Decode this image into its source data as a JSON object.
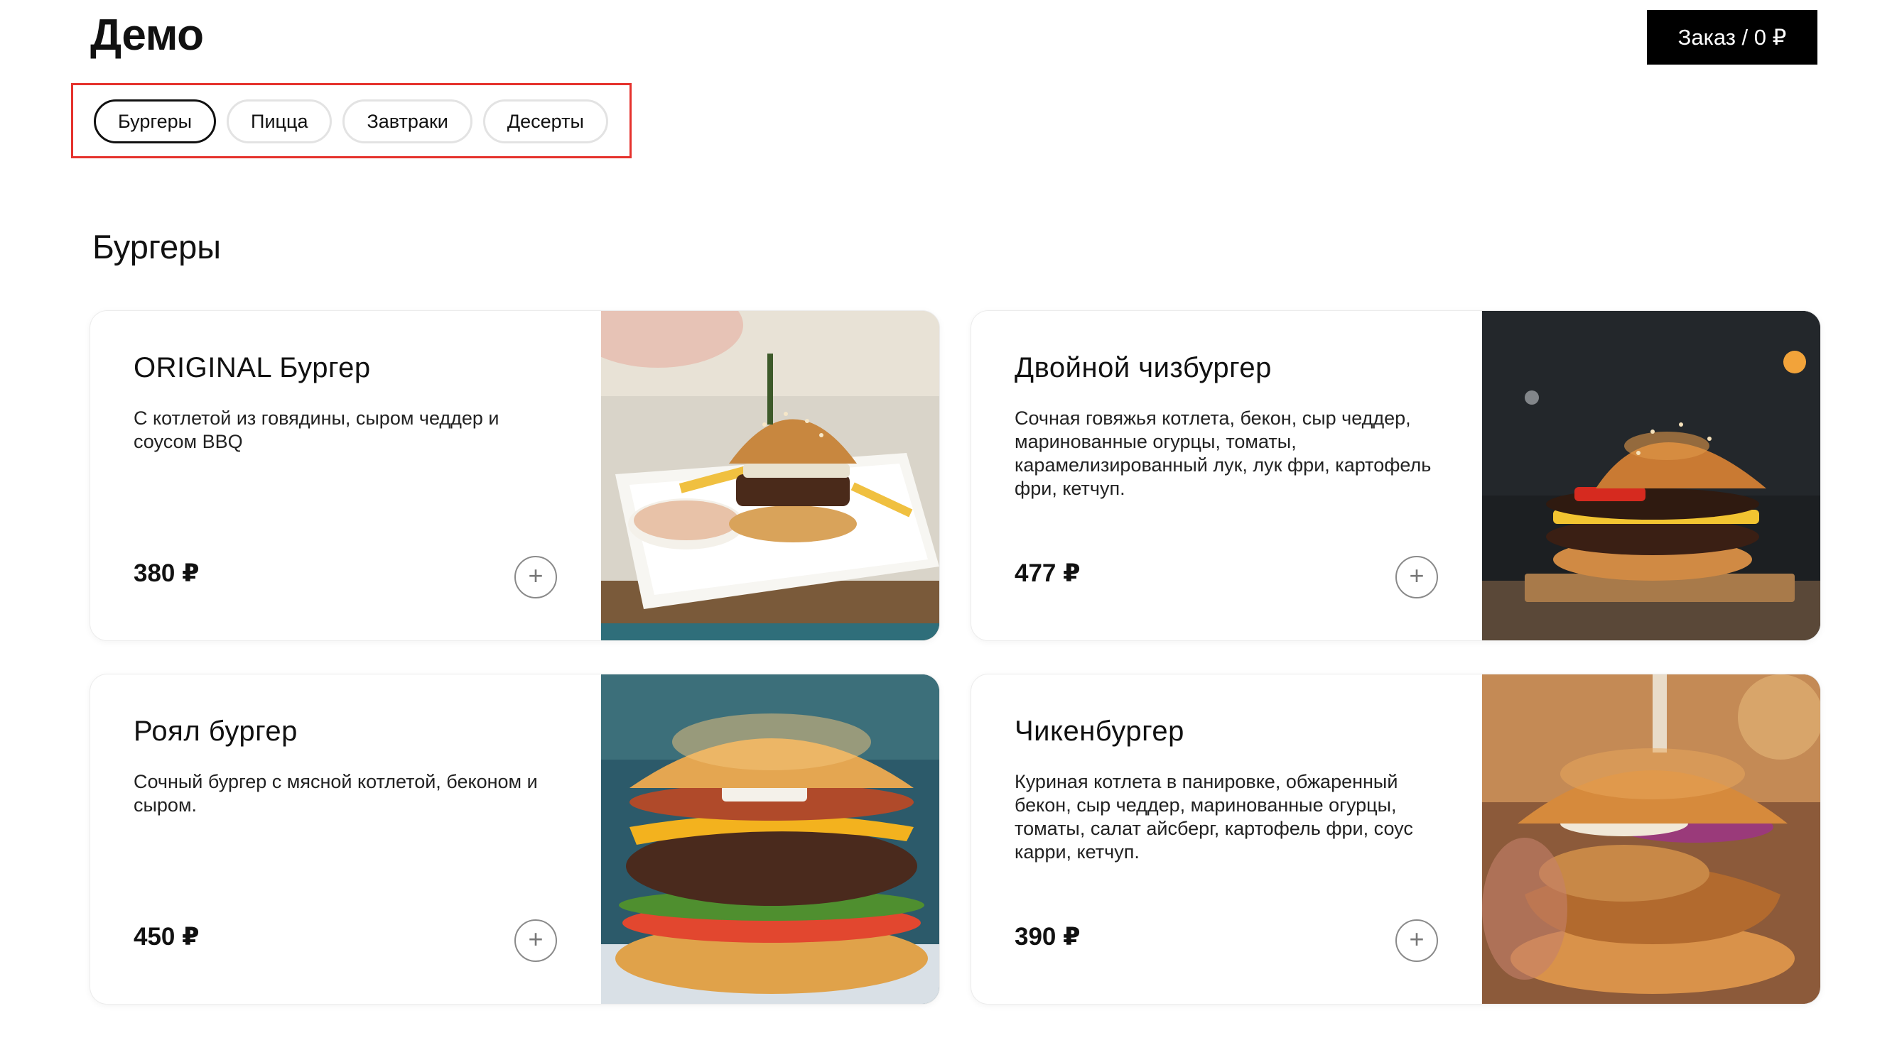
{
  "header": {
    "shop_title": "Демо",
    "order_button": "Заказ / 0 ₽"
  },
  "categories": [
    "Бургеры",
    "Пицца",
    "Завтраки",
    "Десерты"
  ],
  "active_category": "Бургеры",
  "section": {
    "title": "Бургеры"
  },
  "products": [
    {
      "name": "ORIGINAL Бургер",
      "description": "С котлетой из говядины, сыром чеддер и соусом BBQ",
      "price": "380 ₽",
      "add_label": "+",
      "image": "burger-photo-plate-fries-sauce"
    },
    {
      "name": "Двойной чизбургер",
      "description": "Сочная говяжья котлета, бекон, сыр чеддер, маринованные огурцы, томаты, карамелизированный лук, лук фри, картофель фри, кетчуп.",
      "price": "477 ₽",
      "add_label": "+",
      "image": "double-cheeseburger-photo-dark"
    },
    {
      "name": "Роял бургер",
      "description": "Сочный бургер с мясной котлетой, беконом и сыром.",
      "price": "450 ₽",
      "add_label": "+",
      "image": "royal-burger-photo-closeup"
    },
    {
      "name": "Чикенбургер",
      "description": "Куриная котлета в панировке, обжаренный бекон, сыр чеддер, маринованные огурцы, томаты, салат айсберг, картофель фри, соус карри, кетчуп.",
      "price": "390 ₽",
      "add_label": "+",
      "image": "chicken-burger-photo-warm"
    }
  ]
}
